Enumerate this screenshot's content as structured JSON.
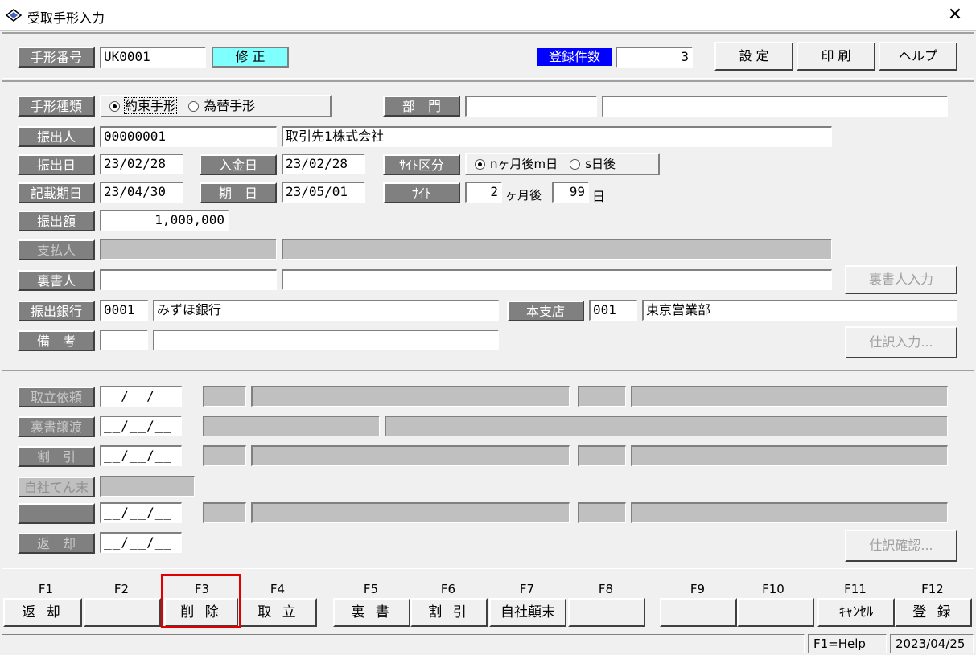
{
  "window": {
    "title": "受取手形入力",
    "close": "✕"
  },
  "header": {
    "note_no_label": "手形番号",
    "note_no": "UK0001",
    "mode": "修 正",
    "count_label": "登録件数",
    "count": "3",
    "settings_btn": "設 定",
    "print_btn": "印 刷",
    "help_btn": "ヘルプ"
  },
  "form": {
    "type_label": "手形種類",
    "type_opt1": "約束手形",
    "type_opt2": "為替手形",
    "dept_label": "部　門",
    "drawer_label": "振出人",
    "drawer_code": "00000001",
    "drawer_name": "取引先1株式会社",
    "issue_date_label": "振出日",
    "issue_date": "23/02/28",
    "deposit_date_label": "入金日",
    "deposit_date": "23/02/28",
    "site_type_label": "ｻｲﾄ区分",
    "site_opt1": "nヶ月後m日",
    "site_opt2": "s日後",
    "record_date_label": "記載期日",
    "record_date": "23/04/30",
    "due_date_label": "期　日",
    "due_date": "23/05/01",
    "site_label": "ｻｲﾄ",
    "site_months": "2",
    "site_months_unit": "ヶ月後",
    "site_days": "99",
    "site_days_unit": "日",
    "amount_label": "振出額",
    "amount": "1,000,000",
    "payer_label": "支払人",
    "endorser_label": "裏書人",
    "endorser_btn": "裏書人入力",
    "bank_label": "振出銀行",
    "bank_code": "0001",
    "bank_name": "みずほ銀行",
    "branch_label": "本支店",
    "branch_code": "001",
    "branch_name": "東京営業部",
    "memo_label": "備　考",
    "journal_btn": "仕訳入力..."
  },
  "lower": {
    "collection_label": "取立依頼",
    "transfer_label": "裏書譲渡",
    "discount_label": "割　引",
    "own_label": "自社てん末",
    "return_label": "返　却",
    "date_placeholder": "__/__/__",
    "journal_confirm_btn": "仕訳確認..."
  },
  "fkeys": {
    "labels": [
      "F1",
      "F2",
      "F3",
      "F4",
      "F5",
      "F6",
      "F7",
      "F8",
      "F9",
      "F10",
      "F11",
      "F12"
    ],
    "buttons": [
      "返 却",
      "",
      "削 除",
      "取 立",
      "裏 書",
      "割 引",
      "自社顛末",
      "",
      "",
      "",
      "ｷｬﾝｾﾙ",
      "登 録"
    ]
  },
  "status": {
    "help": "F1=Help",
    "date": "2023/04/25"
  },
  "colors": {
    "highlight": "#e00000",
    "mode_bg": "#80ffff",
    "count_bg": "#0000ff"
  }
}
